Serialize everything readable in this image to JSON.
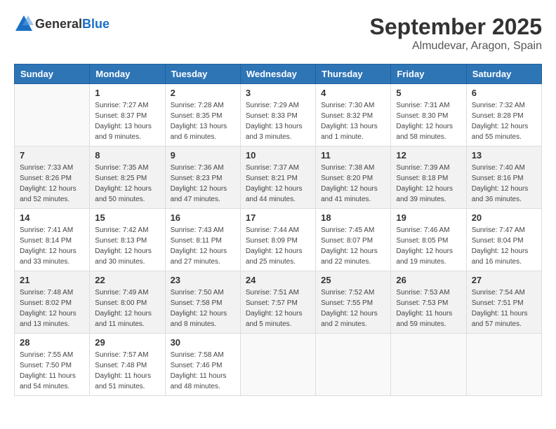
{
  "header": {
    "logo_general": "General",
    "logo_blue": "Blue",
    "month": "September 2025",
    "location": "Almudevar, Aragon, Spain"
  },
  "weekdays": [
    "Sunday",
    "Monday",
    "Tuesday",
    "Wednesday",
    "Thursday",
    "Friday",
    "Saturday"
  ],
  "weeks": [
    [
      {
        "day": "",
        "info": ""
      },
      {
        "day": "1",
        "info": "Sunrise: 7:27 AM\nSunset: 8:37 PM\nDaylight: 13 hours\nand 9 minutes."
      },
      {
        "day": "2",
        "info": "Sunrise: 7:28 AM\nSunset: 8:35 PM\nDaylight: 13 hours\nand 6 minutes."
      },
      {
        "day": "3",
        "info": "Sunrise: 7:29 AM\nSunset: 8:33 PM\nDaylight: 13 hours\nand 3 minutes."
      },
      {
        "day": "4",
        "info": "Sunrise: 7:30 AM\nSunset: 8:32 PM\nDaylight: 13 hours\nand 1 minute."
      },
      {
        "day": "5",
        "info": "Sunrise: 7:31 AM\nSunset: 8:30 PM\nDaylight: 12 hours\nand 58 minutes."
      },
      {
        "day": "6",
        "info": "Sunrise: 7:32 AM\nSunset: 8:28 PM\nDaylight: 12 hours\nand 55 minutes."
      }
    ],
    [
      {
        "day": "7",
        "info": "Sunrise: 7:33 AM\nSunset: 8:26 PM\nDaylight: 12 hours\nand 52 minutes."
      },
      {
        "day": "8",
        "info": "Sunrise: 7:35 AM\nSunset: 8:25 PM\nDaylight: 12 hours\nand 50 minutes."
      },
      {
        "day": "9",
        "info": "Sunrise: 7:36 AM\nSunset: 8:23 PM\nDaylight: 12 hours\nand 47 minutes."
      },
      {
        "day": "10",
        "info": "Sunrise: 7:37 AM\nSunset: 8:21 PM\nDaylight: 12 hours\nand 44 minutes."
      },
      {
        "day": "11",
        "info": "Sunrise: 7:38 AM\nSunset: 8:20 PM\nDaylight: 12 hours\nand 41 minutes."
      },
      {
        "day": "12",
        "info": "Sunrise: 7:39 AM\nSunset: 8:18 PM\nDaylight: 12 hours\nand 39 minutes."
      },
      {
        "day": "13",
        "info": "Sunrise: 7:40 AM\nSunset: 8:16 PM\nDaylight: 12 hours\nand 36 minutes."
      }
    ],
    [
      {
        "day": "14",
        "info": "Sunrise: 7:41 AM\nSunset: 8:14 PM\nDaylight: 12 hours\nand 33 minutes."
      },
      {
        "day": "15",
        "info": "Sunrise: 7:42 AM\nSunset: 8:13 PM\nDaylight: 12 hours\nand 30 minutes."
      },
      {
        "day": "16",
        "info": "Sunrise: 7:43 AM\nSunset: 8:11 PM\nDaylight: 12 hours\nand 27 minutes."
      },
      {
        "day": "17",
        "info": "Sunrise: 7:44 AM\nSunset: 8:09 PM\nDaylight: 12 hours\nand 25 minutes."
      },
      {
        "day": "18",
        "info": "Sunrise: 7:45 AM\nSunset: 8:07 PM\nDaylight: 12 hours\nand 22 minutes."
      },
      {
        "day": "19",
        "info": "Sunrise: 7:46 AM\nSunset: 8:05 PM\nDaylight: 12 hours\nand 19 minutes."
      },
      {
        "day": "20",
        "info": "Sunrise: 7:47 AM\nSunset: 8:04 PM\nDaylight: 12 hours\nand 16 minutes."
      }
    ],
    [
      {
        "day": "21",
        "info": "Sunrise: 7:48 AM\nSunset: 8:02 PM\nDaylight: 12 hours\nand 13 minutes."
      },
      {
        "day": "22",
        "info": "Sunrise: 7:49 AM\nSunset: 8:00 PM\nDaylight: 12 hours\nand 11 minutes."
      },
      {
        "day": "23",
        "info": "Sunrise: 7:50 AM\nSunset: 7:58 PM\nDaylight: 12 hours\nand 8 minutes."
      },
      {
        "day": "24",
        "info": "Sunrise: 7:51 AM\nSunset: 7:57 PM\nDaylight: 12 hours\nand 5 minutes."
      },
      {
        "day": "25",
        "info": "Sunrise: 7:52 AM\nSunset: 7:55 PM\nDaylight: 12 hours\nand 2 minutes."
      },
      {
        "day": "26",
        "info": "Sunrise: 7:53 AM\nSunset: 7:53 PM\nDaylight: 11 hours\nand 59 minutes."
      },
      {
        "day": "27",
        "info": "Sunrise: 7:54 AM\nSunset: 7:51 PM\nDaylight: 11 hours\nand 57 minutes."
      }
    ],
    [
      {
        "day": "28",
        "info": "Sunrise: 7:55 AM\nSunset: 7:50 PM\nDaylight: 11 hours\nand 54 minutes."
      },
      {
        "day": "29",
        "info": "Sunrise: 7:57 AM\nSunset: 7:48 PM\nDaylight: 11 hours\nand 51 minutes."
      },
      {
        "day": "30",
        "info": "Sunrise: 7:58 AM\nSunset: 7:46 PM\nDaylight: 11 hours\nand 48 minutes."
      },
      {
        "day": "",
        "info": ""
      },
      {
        "day": "",
        "info": ""
      },
      {
        "day": "",
        "info": ""
      },
      {
        "day": "",
        "info": ""
      }
    ]
  ]
}
